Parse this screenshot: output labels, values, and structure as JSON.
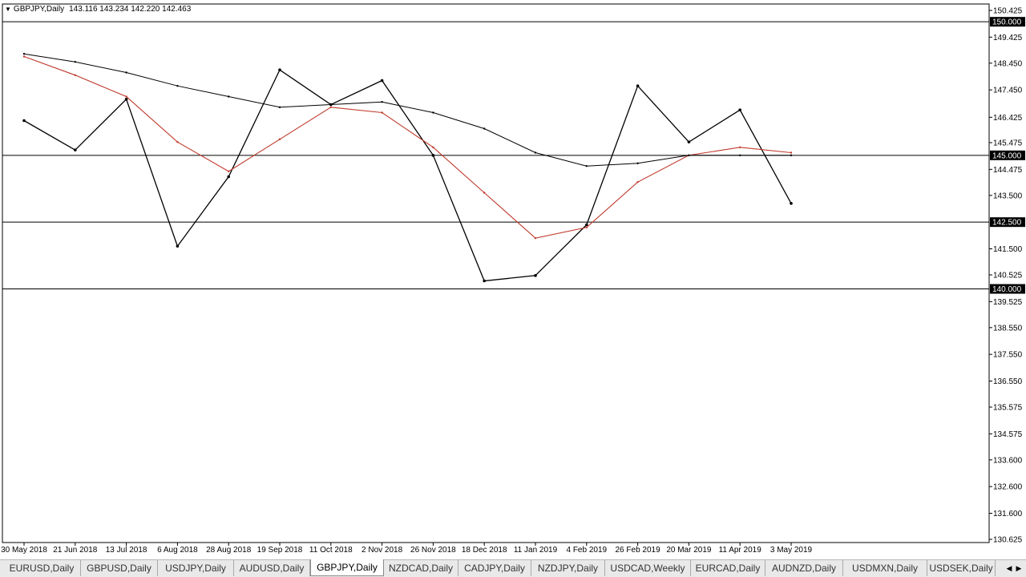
{
  "header": {
    "symbol": "GBPJPY,Daily",
    "ohlc": "143.116 143.234 142.220 142.463"
  },
  "price_axis": {
    "labels": [
      "150.425",
      "149.425",
      "148.450",
      "147.450",
      "146.425",
      "145.475",
      "144.475",
      "143.500",
      "141.500",
      "140.525",
      "139.525",
      "138.550",
      "137.550",
      "136.550",
      "135.575",
      "134.575",
      "133.600",
      "132.600",
      "131.600",
      "130.625"
    ],
    "levels": [
      {
        "price": 150.0,
        "label": "150.000"
      },
      {
        "price": 145.0,
        "label": "145.000"
      },
      {
        "price": 142.5,
        "label": "142.500"
      },
      {
        "price": 140.0,
        "label": "140.000"
      }
    ]
  },
  "time_axis": {
    "labels": [
      "30 May 2018",
      "21 Jun 2018",
      "13 Jul 2018",
      "6 Aug 2018",
      "28 Aug 2018",
      "19 Sep 2018",
      "11 Oct 2018",
      "2 Nov 2018",
      "26 Nov 2018",
      "18 Dec 2018",
      "11 Jan 2019",
      "4 Feb 2019",
      "26 Feb 2019",
      "20 Mar 2019",
      "11 Apr 2019",
      "3 May 2019"
    ]
  },
  "chart_data": {
    "type": "line",
    "title": "GBPJPY,Daily",
    "xlabel": "",
    "ylabel": "",
    "ylim": [
      130.625,
      150.425
    ],
    "grid": false,
    "categories": [
      "30 May 2018",
      "21 Jun 2018",
      "13 Jul 2018",
      "6 Aug 2018",
      "28 Aug 2018",
      "19 Sep 2018",
      "11 Oct 2018",
      "2 Nov 2018",
      "26 Nov 2018",
      "18 Dec 2018",
      "11 Jan 2019",
      "4 Feb 2019",
      "26 Feb 2019",
      "20 Mar 2019",
      "11 Apr 2019",
      "3 May 2019"
    ],
    "series": [
      {
        "values": [
          146.3,
          145.2,
          147.1,
          141.6,
          144.2,
          148.2,
          146.9,
          147.8,
          145.0,
          140.3,
          140.5,
          142.4,
          147.6,
          145.5,
          146.7,
          143.2
        ]
      },
      {
        "values": [
          148.7,
          148.0,
          147.2,
          145.5,
          144.4,
          145.6,
          146.8,
          146.6,
          145.3,
          143.6,
          141.9,
          142.3,
          144.0,
          145.0,
          145.3,
          145.1
        ]
      },
      {
        "values": [
          148.8,
          148.5,
          148.1,
          147.6,
          147.2,
          146.8,
          146.9,
          147.0,
          146.6,
          146.0,
          145.1,
          144.6,
          144.7,
          145.0,
          145.0,
          145.0
        ]
      }
    ],
    "colors": {
      "price": "#000000",
      "ma_fast": "#c0392b",
      "ma_slow": "#000000",
      "level": "#000000"
    }
  },
  "tabs": [
    {
      "label": "EURUSD,Daily",
      "active": false
    },
    {
      "label": "GBPUSD,Daily",
      "active": false
    },
    {
      "label": "USDJPY,Daily",
      "active": false
    },
    {
      "label": "AUDUSD,Daily",
      "active": false
    },
    {
      "label": "GBPJPY,Daily",
      "active": true
    },
    {
      "label": "NZDCAD,Daily",
      "active": false
    },
    {
      "label": "CADJPY,Daily",
      "active": false
    },
    {
      "label": "NZDJPY,Daily",
      "active": false
    },
    {
      "label": "USDCAD,Weekly",
      "active": false
    },
    {
      "label": "EURCAD,Daily",
      "active": false
    },
    {
      "label": "AUDNZD,Daily",
      "active": false
    },
    {
      "label": "USDMXN,Daily",
      "active": false
    },
    {
      "label": "USDSEK,Daily",
      "active": false
    }
  ],
  "icons": {
    "scroll_left": "triangle-left-icon",
    "scroll_right": "triangle-right-icon",
    "collapse": "triangle-down-icon"
  }
}
